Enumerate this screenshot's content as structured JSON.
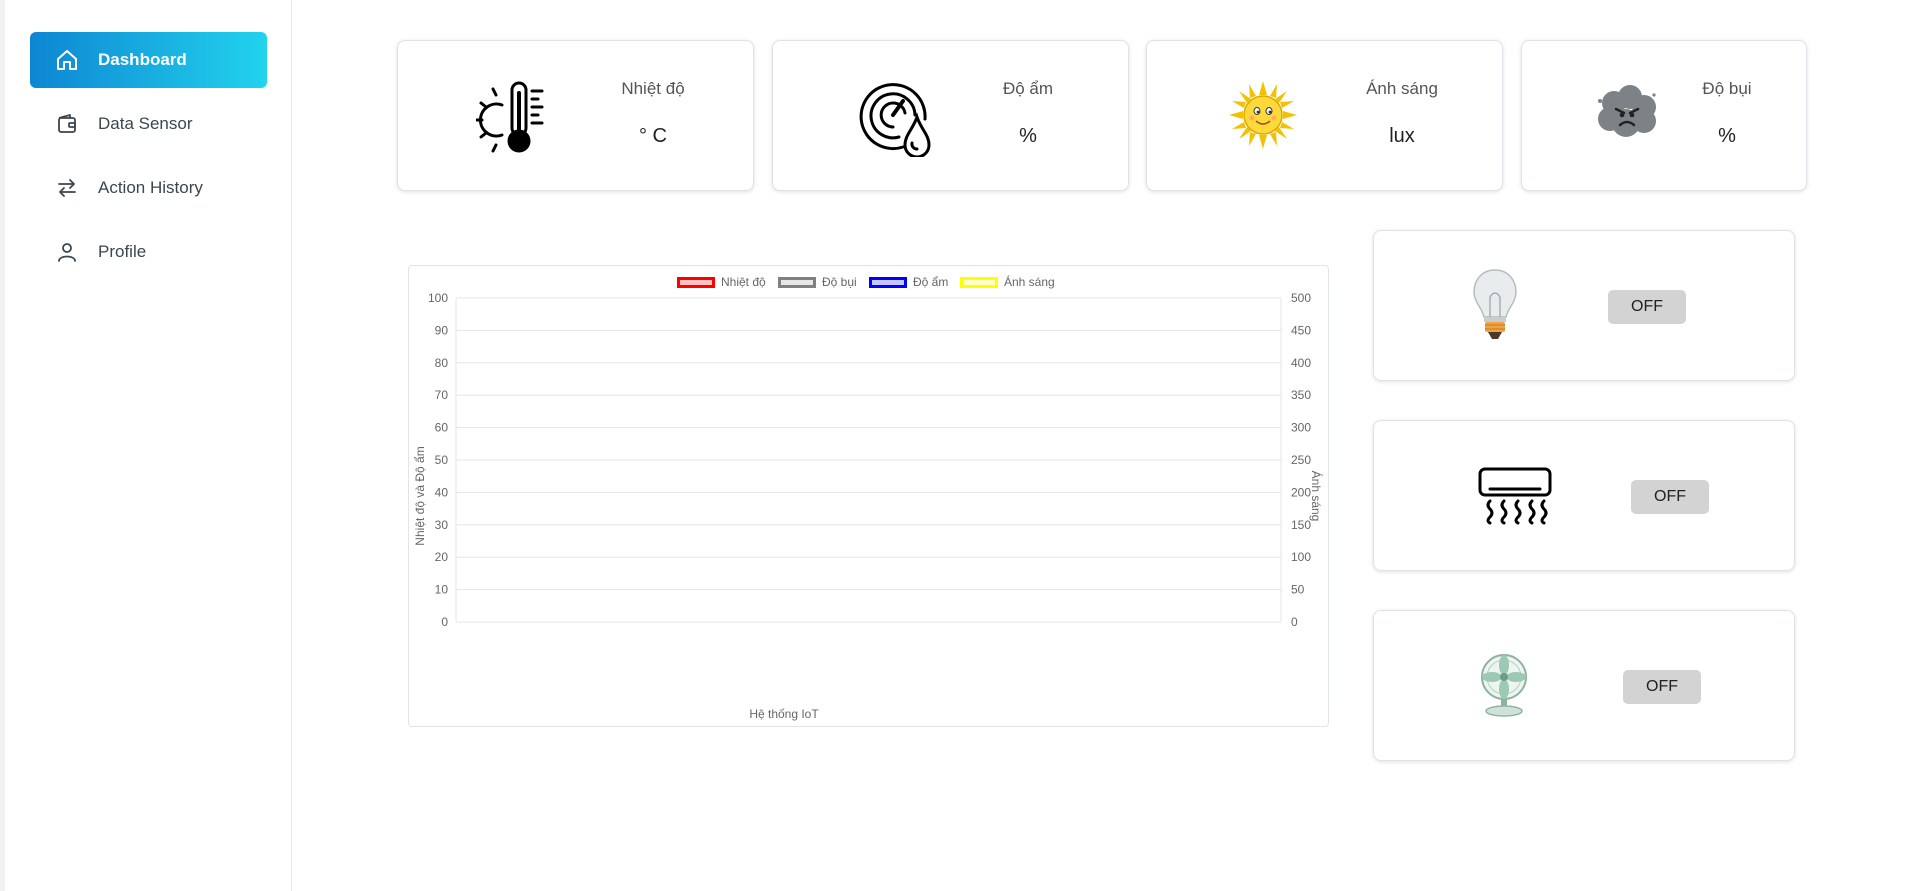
{
  "sidebar": {
    "items": [
      {
        "label": "Dashboard",
        "icon": "home-icon",
        "active": true
      },
      {
        "label": "Data Sensor",
        "icon": "wallet-icon",
        "active": false
      },
      {
        "label": "Action History",
        "icon": "arrows-swap-icon",
        "active": false
      },
      {
        "label": "Profile",
        "icon": "user-icon",
        "active": false
      }
    ]
  },
  "sensors": [
    {
      "label": "Nhiệt độ",
      "value": "° C",
      "icon": "thermometer-sun-icon"
    },
    {
      "label": "Độ ẩm",
      "value": "%",
      "icon": "humidity-gauge-icon"
    },
    {
      "label": "Ánh sáng",
      "value": "lux",
      "icon": "sun-icon"
    },
    {
      "label": "Độ bụi",
      "value": "%",
      "icon": "dust-cloud-icon"
    }
  ],
  "devices": [
    {
      "name": "light",
      "icon": "light-bulb-icon",
      "state": "OFF"
    },
    {
      "name": "air-conditioner",
      "icon": "air-conditioner-icon",
      "state": "OFF"
    },
    {
      "name": "fan",
      "icon": "fan-icon",
      "state": "OFF"
    }
  ],
  "chart_data": {
    "type": "line",
    "xlabel": "Hệ thống IoT",
    "ylabel_left": "Nhiệt độ và Độ ẩm",
    "ylabel_right": "Ánh sáng",
    "ylim_left": [
      0,
      100
    ],
    "ylim_right": [
      0,
      500
    ],
    "yticks_left": [
      "100",
      "90",
      "80",
      "70",
      "60",
      "50",
      "40",
      "30",
      "20",
      "10",
      "0"
    ],
    "yticks_right": [
      "500",
      "450",
      "400",
      "350",
      "300",
      "250",
      "200",
      "150",
      "100",
      "50",
      "0"
    ],
    "grid": true,
    "legend_position": "top",
    "series": [
      {
        "name": "Nhiệt độ",
        "color": "#ff0000",
        "fill": "#ffc0c0",
        "values": []
      },
      {
        "name": "Độ bụi",
        "color": "#808080",
        "fill": "#e6e6e6",
        "values": []
      },
      {
        "name": "Độ ẩm",
        "color": "#0000ff",
        "fill": "#c6c6ff",
        "values": []
      },
      {
        "name": "Ánh sáng",
        "color": "#ffff00",
        "fill": "#ffffcc",
        "values": []
      }
    ]
  }
}
